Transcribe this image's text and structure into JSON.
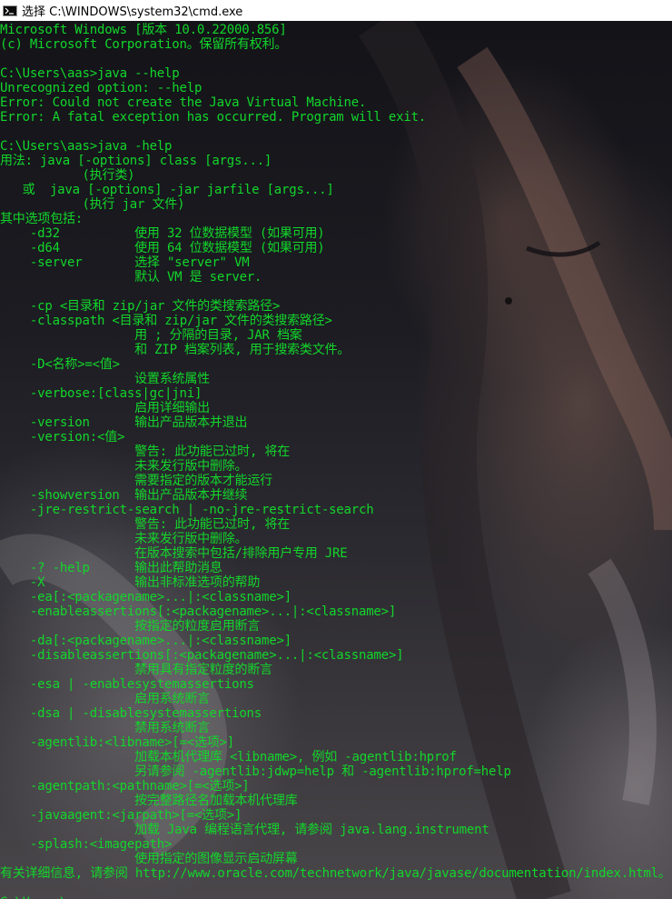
{
  "window": {
    "title": "选择 C:\\WINDOWS\\system32\\cmd.exe"
  },
  "console": {
    "lines": [
      "Microsoft Windows [版本 10.0.22000.856]",
      "(c) Microsoft Corporation。保留所有权利。",
      "",
      "C:\\Users\\aas>java --help",
      "Unrecognized option: --help",
      "Error: Could not create the Java Virtual Machine.",
      "Error: A fatal exception has occurred. Program will exit.",
      "",
      "C:\\Users\\aas>java -help",
      "用法: java [-options] class [args...]",
      "           (执行类)",
      "   或  java [-options] -jar jarfile [args...]",
      "           (执行 jar 文件)",
      "其中选项包括:",
      "    -d32          使用 32 位数据模型 (如果可用)",
      "    -d64          使用 64 位数据模型 (如果可用)",
      "    -server       选择 \"server\" VM",
      "                  默认 VM 是 server.",
      "",
      "    -cp <目录和 zip/jar 文件的类搜索路径>",
      "    -classpath <目录和 zip/jar 文件的类搜索路径>",
      "                  用 ; 分隔的目录, JAR 档案",
      "                  和 ZIP 档案列表, 用于搜索类文件。",
      "    -D<名称>=<值>",
      "                  设置系统属性",
      "    -verbose:[class|gc|jni]",
      "                  启用详细输出",
      "    -version      输出产品版本并退出",
      "    -version:<值>",
      "                  警告: 此功能已过时, 将在",
      "                  未来发行版中删除。",
      "                  需要指定的版本才能运行",
      "    -showversion  输出产品版本并继续",
      "    -jre-restrict-search | -no-jre-restrict-search",
      "                  警告: 此功能已过时, 将在",
      "                  未来发行版中删除。",
      "                  在版本搜索中包括/排除用户专用 JRE",
      "    -? -help      输出此帮助消息",
      "    -X            输出非标准选项的帮助",
      "    -ea[:<packagename>...|:<classname>]",
      "    -enableassertions[:<packagename>...|:<classname>]",
      "                  按指定的粒度启用断言",
      "    -da[:<packagename>...|:<classname>]",
      "    -disableassertions[:<packagename>...|:<classname>]",
      "                  禁用具有指定粒度的断言",
      "    -esa | -enablesystemassertions",
      "                  启用系统断言",
      "    -dsa | -disablesystemassertions",
      "                  禁用系统断言",
      "    -agentlib:<libname>[=<选项>]",
      "                  加载本机代理库 <libname>, 例如 -agentlib:hprof",
      "                  另请参阅 -agentlib:jdwp=help 和 -agentlib:hprof=help",
      "    -agentpath:<pathname>[=<选项>]",
      "                  按完整路径名加载本机代理库",
      "    -javaagent:<jarpath>[=<选项>]",
      "                  加载 Java 编程语言代理, 请参阅 java.lang.instrument",
      "    -splash:<imagepath>",
      "                  使用指定的图像显示启动屏幕",
      "有关详细信息, 请参阅 http://www.oracle.com/technetwork/java/javase/documentation/index.html。",
      "",
      "C:\\Users\\aas>"
    ]
  },
  "colors": {
    "text": "#13d62b",
    "titlebar": "#ffffff"
  }
}
